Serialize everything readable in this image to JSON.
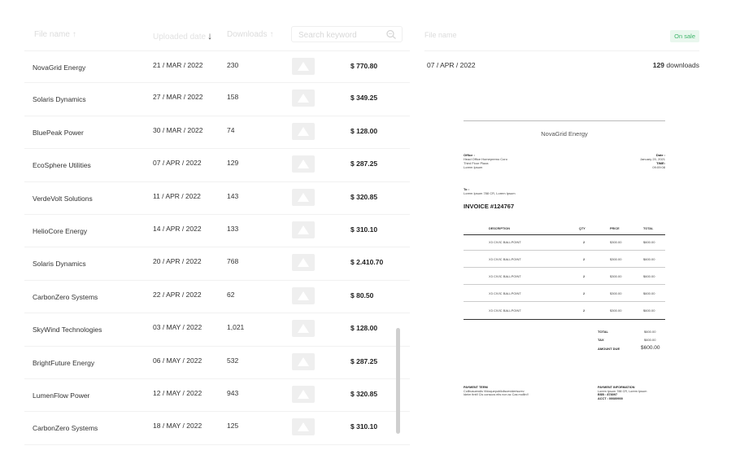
{
  "table": {
    "headers": {
      "file_name": "File name",
      "uploaded_date": "Uploaded date",
      "downloads": "Downloads",
      "search_placeholder": "Search keyword"
    },
    "rows": [
      {
        "name": "NovaGrid Energy",
        "date": "21 / MAR / 2022",
        "downloads": "230",
        "price": "$ 770.80"
      },
      {
        "name": "Solaris Dynamics",
        "date": "27 / MAR / 2022",
        "downloads": "158",
        "price": "$ 349.25"
      },
      {
        "name": "BluePeak Power",
        "date": "30 / MAR / 2022",
        "downloads": "74",
        "price": "$ 128.00"
      },
      {
        "name": "EcoSphere Utilities",
        "date": "07 / APR / 2022",
        "downloads": "129",
        "price": "$ 287.25"
      },
      {
        "name": "VerdeVolt Solutions",
        "date": "11 / APR / 2022",
        "downloads": "143",
        "price": "$ 320.85"
      },
      {
        "name": "HelioCore Energy",
        "date": "14 / APR / 2022",
        "downloads": "133",
        "price": "$ 310.10"
      },
      {
        "name": "Solaris Dynamics",
        "date": "20 / APR / 2022",
        "downloads": "768",
        "price": "$ 2.410.70"
      },
      {
        "name": "CarbonZero Systems",
        "date": "22 / APR / 2022",
        "downloads": "62",
        "price": "$ 80.50"
      },
      {
        "name": "SkyWind Technologies",
        "date": "03 / MAY / 2022",
        "downloads": "1,021",
        "price": "$ 128.00"
      },
      {
        "name": "BrightFuture Energy",
        "date": "06 / MAY / 2022",
        "downloads": "532",
        "price": "$ 287.25"
      },
      {
        "name": "LumenFlow Power",
        "date": "12 / MAY / 2022",
        "downloads": "943",
        "price": "$ 320.85"
      },
      {
        "name": "CarbonZero Systems",
        "date": "18 / MAY / 2022",
        "downloads": "125",
        "price": "$ 310.10"
      }
    ]
  },
  "panel": {
    "file_name_label": "File name",
    "status_badge": "On sale",
    "date": "07 / APR / 2022",
    "downloads_count": "129",
    "downloads_label": "downloads"
  },
  "invoice": {
    "company": "NovaGrid Energy",
    "office_label": "Office :",
    "office_lines": [
      "Head Office Homepremo Coro",
      "Third Floor Plaza",
      "Lorem Ipsum"
    ],
    "date_label": "Date :",
    "date_value": "January 20, 2021",
    "time_label": "TIME:",
    "time_value": "09:09:08",
    "to_label": "To :",
    "to_value": "Lorem Ipsum 788 CR, Lorem Ipsum",
    "number": "INVOICE #124767",
    "col_description": "DESCRIPTION",
    "col_qty": "QTY",
    "col_price": "PRICE",
    "col_total": "TOTAL",
    "items": [
      {
        "desc": "X3 CIVIC BALLPOINT",
        "qty": "2",
        "price": "$300.00",
        "total": "$600.00"
      },
      {
        "desc": "X3 CIVIC BALLPOINT",
        "qty": "2",
        "price": "$300.00",
        "total": "$600.00"
      },
      {
        "desc": "X3 CIVIC BALLPOINT",
        "qty": "2",
        "price": "$300.00",
        "total": "$600.00"
      },
      {
        "desc": "X3 CIVIC BALLPOINT",
        "qty": "2",
        "price": "$300.00",
        "total": "$600.00"
      },
      {
        "desc": "X3 CIVIC BALLPOINT",
        "qty": "2",
        "price": "$300.00",
        "total": "$600.00"
      }
    ],
    "total_label": "TOTAL",
    "total_value": "$600.00",
    "tax_label": "TAX",
    "tax_value": "$600.00",
    "amount_due_label": "AMOUNT DUE",
    "amount_due_value": "$600.00",
    "payment_term_label": "PAYMENT TERM",
    "payment_term_lines": [
      "Cullbusuendis Vidoquepubliclisceviderisurev",
      "Ideim ttntt! Cis conscos eits non ac Cas molltn!!"
    ],
    "payment_info_label": "PAYMENT INFORMATION",
    "payment_info_lines": [
      "Lorem Ipsum 788 CR, Lorem Ipsum",
      "BSB : 878097",
      "ACCT : 00089900"
    ]
  },
  "colors": {
    "badge_bg": "#e9f7ee",
    "badge_text": "#3fb56b"
  }
}
